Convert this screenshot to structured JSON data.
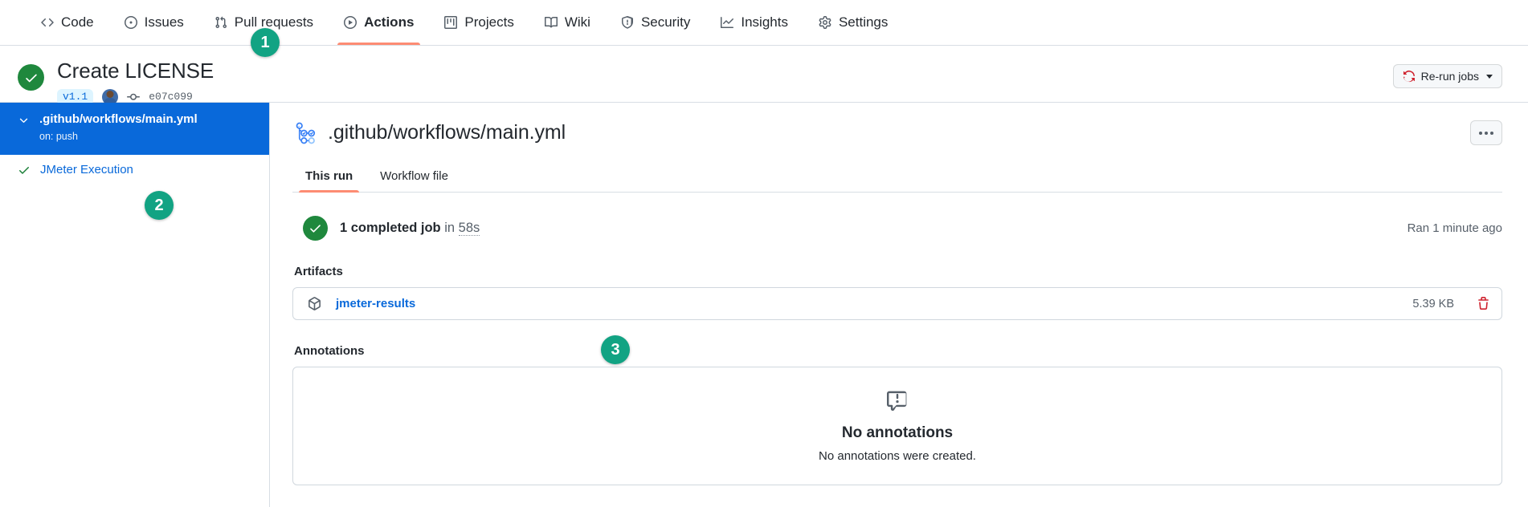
{
  "repo_nav": {
    "items": [
      {
        "label": "Code",
        "icon": "code-icon",
        "active": false
      },
      {
        "label": "Issues",
        "icon": "issue-opened-icon",
        "active": false
      },
      {
        "label": "Pull requests",
        "icon": "git-pull-request-icon",
        "active": false
      },
      {
        "label": "Actions",
        "icon": "play-circle-icon",
        "active": true
      },
      {
        "label": "Projects",
        "icon": "project-board-icon",
        "active": false
      },
      {
        "label": "Wiki",
        "icon": "book-icon",
        "active": false
      },
      {
        "label": "Security",
        "icon": "shield-icon",
        "active": false
      },
      {
        "label": "Insights",
        "icon": "graph-icon",
        "active": false
      },
      {
        "label": "Settings",
        "icon": "gear-icon",
        "active": false
      }
    ]
  },
  "run_header": {
    "title": "Create LICENSE",
    "tag": "v1.1",
    "commit_sha": "e07c099",
    "status": "success",
    "rerun_label": "Re-run jobs",
    "rerun_icon": "sync-icon"
  },
  "sidebar": {
    "workflow": {
      "name": ".github/workflows/main.yml",
      "trigger": "on: push"
    },
    "jobs": [
      {
        "name": "JMeter Execution",
        "status": "success"
      }
    ]
  },
  "main": {
    "title": ".github/workflows/main.yml",
    "title_icon": "workflow-icon",
    "kebab_icon": "kebab-horizontal-icon",
    "tabs": [
      {
        "label": "This run",
        "active": true
      },
      {
        "label": "Workflow file",
        "active": false
      }
    ],
    "summary": {
      "jobs_text": "1 completed job",
      "in_word": "in",
      "duration": "58s",
      "ran_ago": "Ran 1 minute ago"
    },
    "artifacts": {
      "heading": "Artifacts",
      "items": [
        {
          "name": "jmeter-results",
          "size": "5.39 KB",
          "icon": "package-icon",
          "delete_icon": "trash-icon"
        }
      ]
    },
    "annotations": {
      "heading": "Annotations",
      "empty_icon": "comment-alert-icon",
      "empty_title": "No annotations",
      "empty_subtitle": "No annotations were created."
    }
  },
  "step_badges": [
    {
      "number": "1"
    },
    {
      "number": "2"
    },
    {
      "number": "3"
    }
  ],
  "colors": {
    "accent_blue": "#0969da",
    "success_green": "#1f883d",
    "tab_underline": "#fd8c73",
    "badge_teal": "#12a383",
    "danger_red": "#cf222e"
  }
}
